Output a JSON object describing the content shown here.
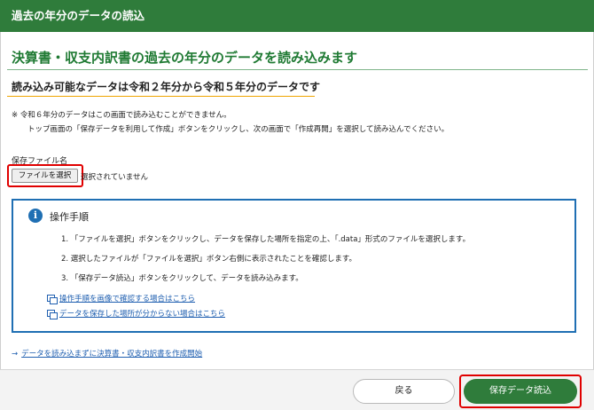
{
  "window": {
    "title": "過去の年分のデータの読込"
  },
  "main": {
    "heading": "決算書・収支内訳書の過去の年分のデータを読み込みます",
    "subheading": "読み込み可能なデータは令和２年分から令和５年分のデータです",
    "note_line1": "※  令和６年分のデータはこの画面で読み込むことができません。",
    "note_line2": "トップ画面の「保存データを利用して作成」ボタンをクリックし、次の画面で「作成再開」を選択して読み込んでください。"
  },
  "file": {
    "label": "保存ファイル名",
    "button": "ファイルを選択",
    "status": "選択されていません"
  },
  "info": {
    "icon": "i",
    "title": "操作手順",
    "steps": [
      "1. 「ファイルを選択」ボタンをクリックし、データを保存した場所を指定の上、「.data」形式のファイルを選択します。",
      "2. 選択したファイルが「ファイルを選択」ボタン右側に表示されたことを確認します。",
      "3. 「保存データ読込」ボタンをクリックして、データを読み込みます。"
    ],
    "links": [
      "操作手順を画像で確認する場合はこちら",
      "データを保存した場所が分からない場合はこちら"
    ]
  },
  "bottom_link": {
    "arrow": "→",
    "text": "データを読み込まずに決算書・収支内訳書を作成開始"
  },
  "footer": {
    "back_label": "戻る",
    "load_label": "保存データ読込"
  },
  "colors": {
    "brand_green": "#2f7c3b",
    "info_blue": "#1f6fb3",
    "highlight_red": "#e00000",
    "accent_orange": "#f0a500"
  }
}
